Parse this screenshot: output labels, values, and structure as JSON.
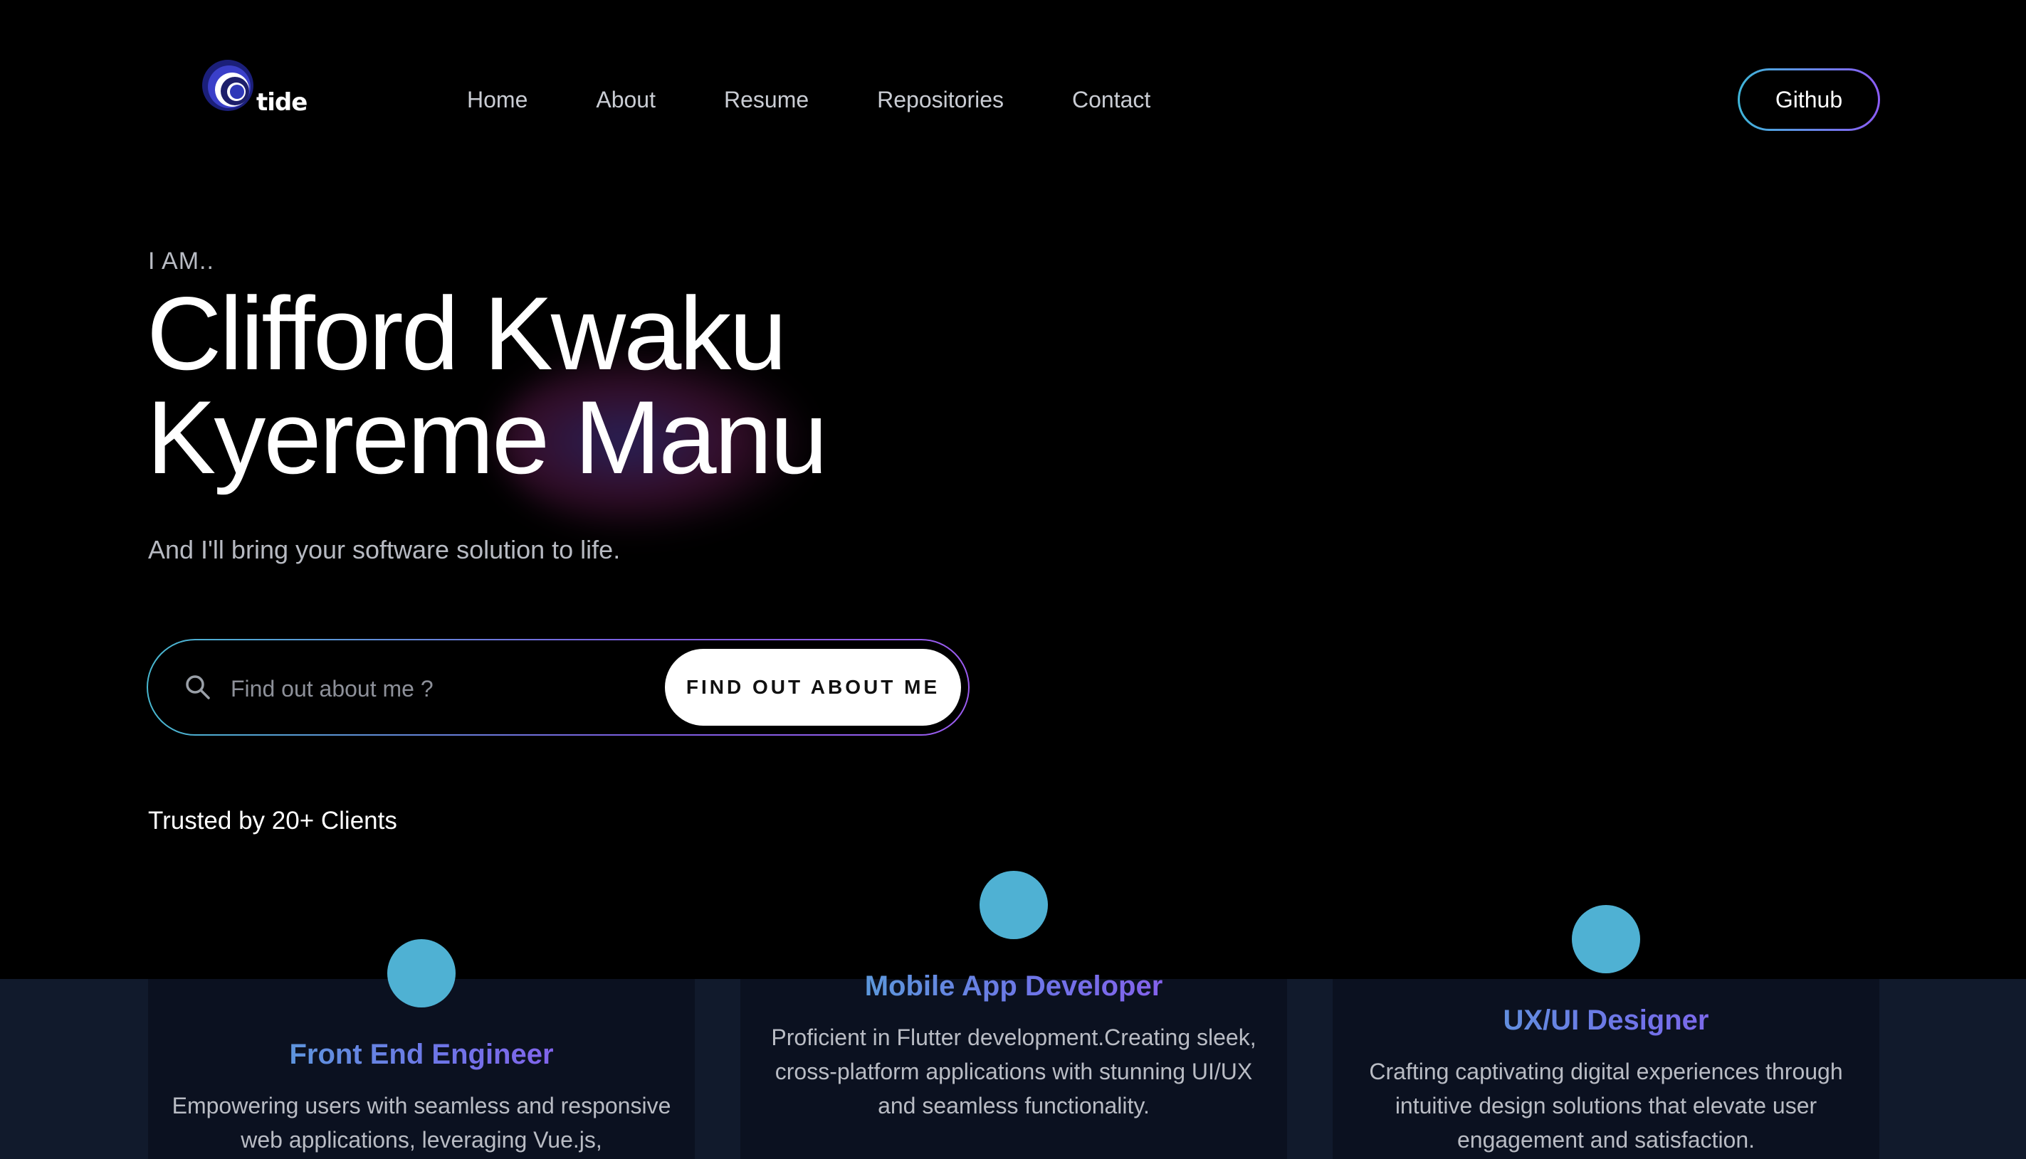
{
  "nav": {
    "logo_text": "tide",
    "links": [
      "Home",
      "About",
      "Resume",
      "Repositories",
      "Contact"
    ],
    "github_label": "Github"
  },
  "hero": {
    "eyebrow": "I AM..",
    "name_line1": "Clifford Kwaku",
    "name_line2": "Kyereme Manu",
    "tagline": "And I'll bring your software solution to life.",
    "search": {
      "placeholder": "Find out about me ?",
      "value": "",
      "button_label": "FIND OUT ABOUT ME"
    },
    "trusted": "Trusted by 20+ Clients"
  },
  "services": [
    {
      "title": "Front End Engineer",
      "description": "Empowering users with seamless and responsive web applications, leveraging Vue.js,"
    },
    {
      "title": "Mobile App Developer",
      "description": "Proficient in Flutter development.Creating sleek, cross-platform applications with stunning UI/UX and seamless functionality."
    },
    {
      "title": "UX/UI Designer",
      "description": "Crafting captivating digital experiences through intuitive design solutions that elevate user engagement and satisfaction."
    }
  ],
  "colors": {
    "background": "#000000",
    "accent_cyan": "#4fb1d3",
    "accent_purple": "#8b5cf6",
    "services_band": "#111a2c",
    "card_bg": "#0b1120"
  },
  "icons": {
    "logo": "tide-logo-mark",
    "search": "search-icon"
  }
}
